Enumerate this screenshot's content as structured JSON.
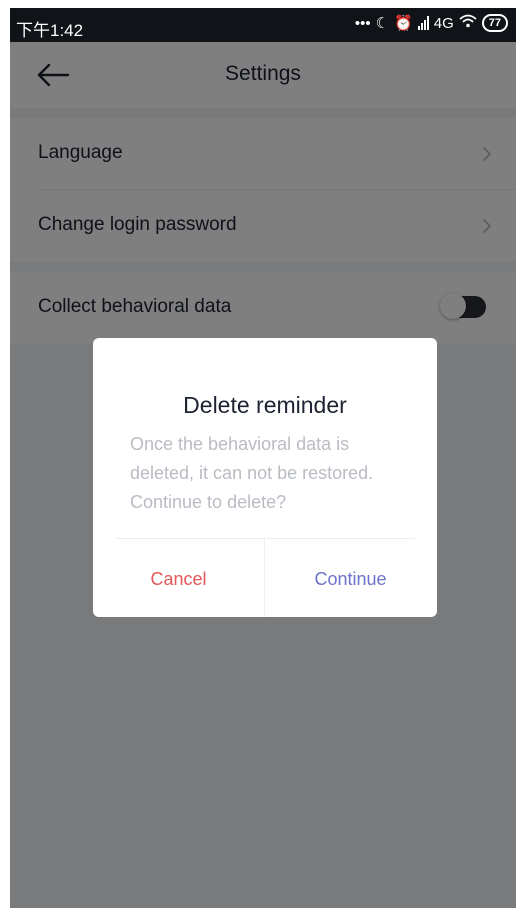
{
  "status_bar": {
    "time": "下午1:42",
    "network": "4G",
    "battery": "77"
  },
  "header": {
    "title": "Settings",
    "back_icon": "arrow-left-icon"
  },
  "settings": {
    "items": [
      {
        "label": "Language",
        "icon": "chevron-right-icon"
      },
      {
        "label": "Change login password",
        "icon": "chevron-right-icon"
      }
    ],
    "behavioral": {
      "label": "Collect behavioral data",
      "toggle_on": false
    }
  },
  "dialog": {
    "title": "Delete reminder",
    "message": "Once the behavioral data is deleted, it can not be restored. Continue to delete?",
    "cancel_label": "Cancel",
    "continue_label": "Continue"
  },
  "colors": {
    "cancel": "#e35757",
    "continue": "#6a73c8",
    "text_primary": "#1d2333",
    "text_muted": "#b9bcc3"
  }
}
